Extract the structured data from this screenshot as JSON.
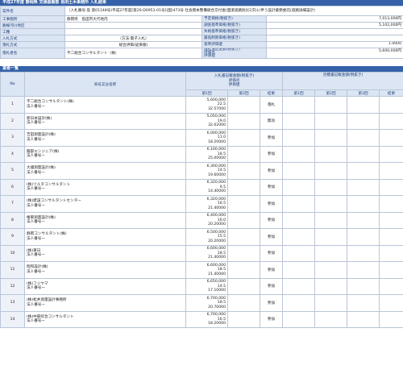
{
  "header": {
    "title": "平成27年度  静岡県  交通基盤部  島田土木事務所  入札結果"
  },
  "info_rows": [
    {
      "label": "案件名",
      "value": "（入札番号:島 第01148号)平成27年度[第26-D0951-01号](国)473号 社会資本整備総合交付金(国道道路防災2次)に伴う設計業務委託(道路詳細設計)",
      "label2": "",
      "value2": ""
    },
    {
      "label": "工事箇所",
      "value": "静岡県　島田市大代地内",
      "label2": "予定価格(税抜き)",
      "value2": "7,013,000円"
    },
    {
      "label": "路線河川地区",
      "value": "",
      "label2": "調査基準価格(税抜き)",
      "value2": "5,102,000円"
    },
    {
      "label": "工種",
      "value": "",
      "label2": "失格基準価格(税抜き)",
      "value2": ""
    },
    {
      "label": "入札方式",
      "value": "（方法:電子入札）",
      "label2": "最低制限価格(税抜き)",
      "value2": ""
    },
    {
      "label": "落札方式",
      "value": "総合評価(従来版)",
      "label2": "基準評価値",
      "value2": "1.0000"
    },
    {
      "label": "落札者名",
      "value": "不二総合コンサルタント（株）",
      "label2": "落札決定金額(税抜き)\n評価点\n評価値",
      "value2": "5,600,000円"
    }
  ],
  "bids_section": {
    "title": "業者一覧"
  },
  "columns": {
    "no": "No",
    "name": "商号又は名称",
    "group1": "入札書記載金額(税抜き)\n評価点\n評価値",
    "group2": "見積書記載金額(税抜き)",
    "r1": "第1回",
    "r2": "第2回",
    "r3": "第3回",
    "result": "結果"
  },
  "bids": [
    {
      "no": "1",
      "name": "不二総合コンサルタント(株)\n法人番号ー",
      "v": "5,600,000\n22.5\n32.57000",
      "result": "落札"
    },
    {
      "no": "2",
      "name": "新日本設計(株)\n法人番号ー",
      "v": "5,050,000\n19.0\n32.62000",
      "result": "無効"
    },
    {
      "no": "3",
      "name": "吉田測量設計(株)\n法人番号ー",
      "v": "6,000,000\n11.0\n18.20000",
      "result": "参加"
    },
    {
      "no": "4",
      "name": "服部エンジニア(株)\n法人番号ー",
      "v": "6,100,000\n18.5\n25.00000",
      "result": "参加"
    },
    {
      "no": "5",
      "name": "大鐘測量設計(株)\n法人番号ー",
      "v": "6,300,000\n14.5\n19.60000",
      "result": "参加"
    },
    {
      "no": "6",
      "name": "(株)ツルタコンサルタント\n法人番号ー",
      "v": "6,320,000\n9.5\n14.40000",
      "result": "参加"
    },
    {
      "no": "7",
      "name": "(株)建設コンサルタントセンター\n法人番号ー",
      "v": "6,320,000\n16.5\n21.40000",
      "result": "参加"
    },
    {
      "no": "8",
      "name": "榛東測量設計(株)\n法人番号ー",
      "v": "6,400,000\n16.0\n20.20000",
      "result": "参加"
    },
    {
      "no": "9",
      "name": "静岡コンサルタント(株)\n法人番号ー",
      "v": "6,500,000\n15.5\n20.20000",
      "result": "参加"
    },
    {
      "no": "10",
      "name": "(株)東日\n法人番号ー",
      "v": "6,600,000\n18.5\n21.40000",
      "result": "参加"
    },
    {
      "no": "11",
      "name": "昭和設計(株)\n法人番号ー",
      "v": "6,600,000\n18.5\n21.40000",
      "result": "参加"
    },
    {
      "no": "12",
      "name": "(株)フジヤマ\n法人番号ー",
      "v": "6,650,000\n14.5\n17.10000",
      "result": "参加"
    },
    {
      "no": "13",
      "name": "(株)松井測量設計事務所\n法人番号ー",
      "v": "6,700,000\n18.5\n20.70000",
      "result": "参加"
    },
    {
      "no": "14",
      "name": "(株)中部綜合コンサルタント\n法人番号ー",
      "v": "6,700,000\n16.5\n18.20000",
      "result": "参加"
    }
  ]
}
